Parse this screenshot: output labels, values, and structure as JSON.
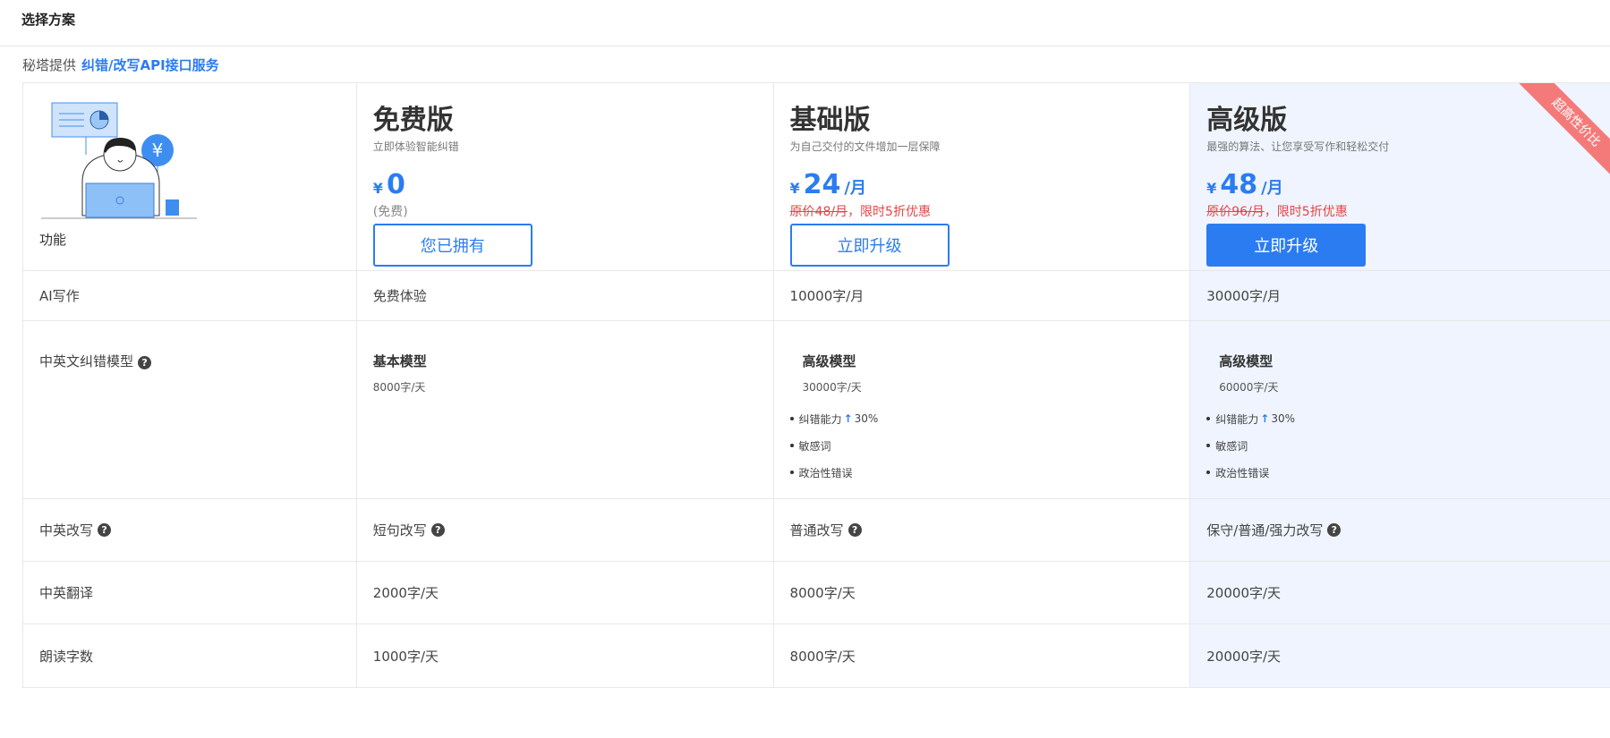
{
  "header": {
    "title": "选择方案"
  },
  "sub": {
    "prefix": "秘塔提供",
    "link": "纠错/改写API接口服务"
  },
  "feature_col_label": "功能",
  "plans": [
    {
      "name": "免费版",
      "desc": "立即体验智能纠错",
      "currency": "¥",
      "price": "0",
      "unit": "",
      "note": "(免费)",
      "note_strike": "",
      "note_suffix": "",
      "button": "您已拥有"
    },
    {
      "name": "基础版",
      "desc": "为自己交付的文件增加一层保障",
      "currency": "¥",
      "price": "24",
      "unit": "/月",
      "note": "",
      "note_strike": "原价48/月",
      "note_suffix": "，限时5折优惠",
      "button": "立即升级"
    },
    {
      "name": "高级版",
      "desc": "最强的算法、让您享受写作和轻松交付",
      "currency": "¥",
      "price": "48",
      "unit": "/月",
      "note": "",
      "note_strike": "原价96/月",
      "note_suffix": "，限时5折优惠",
      "button": "立即升级",
      "ribbon": "超高性价比"
    }
  ],
  "rows": {
    "ai": {
      "label": "AI写作",
      "free": "免费体验",
      "basic": "10000字/月",
      "pro": "30000字/月"
    },
    "model": {
      "label": "中英文纠错模型",
      "free": {
        "title": "基本模型",
        "quota": "8000字/天"
      },
      "basic": {
        "title": "高级模型",
        "quota": "30000字/天",
        "items": [
          "纠错能力",
          "30%",
          "敏感词",
          "政治性错误"
        ]
      },
      "pro": {
        "title": "高级模型",
        "quota": "60000字/天",
        "items": [
          "纠错能力",
          "30%",
          "敏感词",
          "政治性错误"
        ]
      }
    },
    "rewrite": {
      "label": "中英改写",
      "free": "短句改写",
      "basic": "普通改写",
      "pro": "保守/普通/强力改写"
    },
    "translate": {
      "label": "中英翻译",
      "free": "2000字/天",
      "basic": "8000字/天",
      "pro": "20000字/天"
    },
    "read": {
      "label": "朗读字数",
      "free": "1000字/天",
      "basic": "8000字/天",
      "pro": "20000字/天"
    }
  },
  "colors": {
    "accent": "#2b7cf1",
    "discount": "#e64545",
    "pro_bg": "#eff4fe",
    "ribbon": "#f47a7a"
  }
}
